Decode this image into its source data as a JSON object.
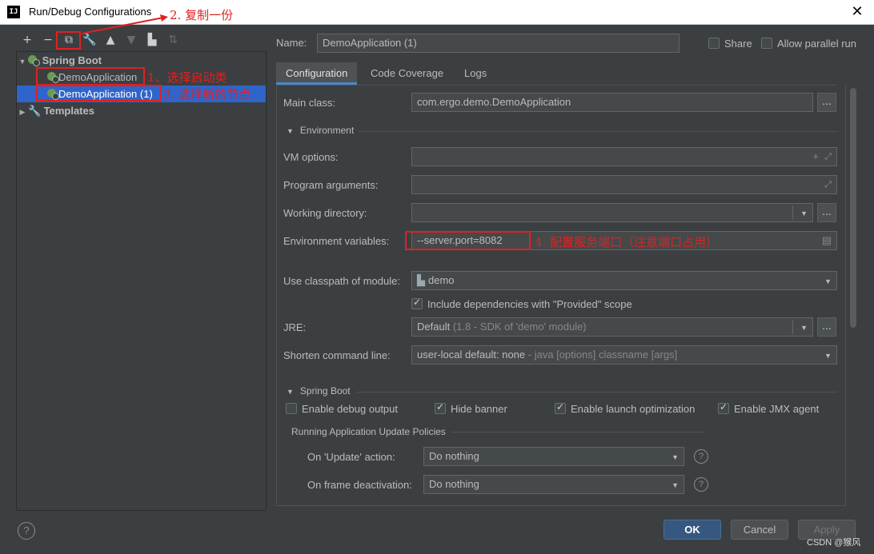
{
  "window": {
    "title": "Run/Debug Configurations",
    "close": "✕",
    "app_icon": "IJ"
  },
  "toolbar": [
    {
      "name": "add-icon",
      "glyph": "+",
      "dim": false
    },
    {
      "name": "remove-icon",
      "glyph": "−",
      "dim": false
    },
    {
      "name": "copy-icon",
      "glyph": "⧉",
      "dim": false
    },
    {
      "name": "wrench-icon",
      "glyph": "🔧",
      "dim": false
    },
    {
      "name": "move-up-icon",
      "glyph": "▲",
      "dim": false
    },
    {
      "name": "move-down-icon",
      "glyph": "▼",
      "dim": true
    },
    {
      "name": "new-folder-icon",
      "glyph": "▙",
      "dim": false
    },
    {
      "name": "sort-icon",
      "glyph": "⇅",
      "dim": true
    }
  ],
  "tree": {
    "group_spring_boot": "Spring Boot",
    "item_1": "DemoApplication",
    "item_2": "DemoApplication (1)",
    "group_templates": "Templates"
  },
  "name_label": "Name:",
  "name_value": "DemoApplication (1)",
  "share_label": "Share",
  "parallel_label": "Allow parallel run",
  "tabs": [
    "Configuration",
    "Code Coverage",
    "Logs"
  ],
  "form": {
    "main_class_label": "Main class:",
    "main_class_value": "com.ergo.demo.DemoApplication",
    "environment_section": "Environment",
    "vm_options_label": "VM options:",
    "program_args_label": "Program arguments:",
    "working_dir_label": "Working directory:",
    "env_vars_label": "Environment variables:",
    "env_vars_value": "--server.port=8082",
    "classpath_label": "Use classpath of module:",
    "classpath_value": "demo",
    "include_deps_label": "Include dependencies with \"Provided\" scope",
    "jre_label": "JRE:",
    "jre_value": "Default",
    "jre_hint": "(1.8 - SDK of 'demo' module)",
    "shorten_label": "Shorten command line:",
    "shorten_value": "user-local default: none",
    "shorten_hint": "- java [options] classname [args]",
    "ellipsis": "..."
  },
  "spring": {
    "section": "Spring Boot",
    "debug_output": "Enable debug output",
    "hide_banner": "Hide banner",
    "launch_opt": "Enable launch optimization",
    "jmx": "Enable JMX agent",
    "policies_title": "Running Application Update Policies",
    "on_update_label": "On 'Update' action:",
    "on_update_value": "Do nothing",
    "on_frame_label": "On frame deactivation:",
    "on_frame_value": "Do nothing"
  },
  "buttons": {
    "ok": "OK",
    "cancel": "Cancel",
    "apply": "Apply",
    "help": "?"
  },
  "annotations": {
    "a1": "1、选择启动类",
    "a2": "2. 复制一份",
    "a3": "3. 选择新的节点",
    "a4": "4. 配置服务端口（注意端口占用）"
  },
  "watermark": "CSDN @猴风"
}
